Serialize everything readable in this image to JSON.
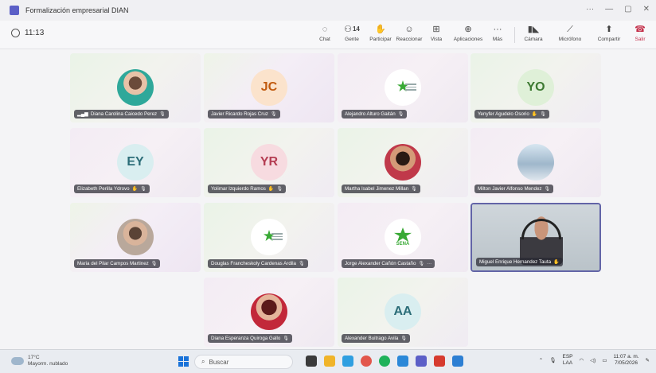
{
  "window": {
    "title": "Formalización empresarial DIAN",
    "controls": [
      "···",
      "—",
      "▢",
      "✕"
    ]
  },
  "toolbar": {
    "timer": "11:13",
    "buttons": [
      {
        "label": "Chat",
        "icon": "chat-icon",
        "glyph": "💬"
      },
      {
        "label": "Gente",
        "icon": "people-icon",
        "glyph": "👥",
        "count": "14"
      },
      {
        "label": "Participar",
        "icon": "raise-hand-icon",
        "glyph": "✋"
      },
      {
        "label": "Reaccionar",
        "icon": "react-icon",
        "glyph": "☺"
      },
      {
        "label": "Vista",
        "icon": "view-icon",
        "glyph": "⊞"
      },
      {
        "label": "Aplicaciones",
        "icon": "apps-icon",
        "glyph": "⊞"
      },
      {
        "label": "Más",
        "icon": "more-icon",
        "glyph": "···"
      },
      {
        "label": "Cámara",
        "icon": "camera-off-icon",
        "glyph": "📷"
      },
      {
        "label": "Micrófono",
        "icon": "mic-off-icon",
        "glyph": "🎙"
      },
      {
        "label": "Compartir",
        "icon": "share-icon",
        "glyph": "⬆"
      },
      {
        "label": "Salir",
        "icon": "leave-icon",
        "glyph": "☎"
      }
    ]
  },
  "participants": [
    {
      "name": "Diana Carolina Caicedo Perez",
      "avatar": "photo",
      "muted": true,
      "signal": true
    },
    {
      "name": "Javier Ricardo Rojas Cruz",
      "initials": "JC",
      "muted": true
    },
    {
      "name": "Alejandro Alturo Gaitán",
      "avatar": "logo",
      "muted": true
    },
    {
      "name": "Yenyfer Agudelo Osorio",
      "initials": "YO",
      "muted": true,
      "hand": true
    },
    {
      "name": "Elizabeth Perilla Ydrovo",
      "initials": "EY",
      "muted": true,
      "hand": true
    },
    {
      "name": "Yolimar Izquierdo Ramos",
      "initials": "YR",
      "muted": true,
      "hand": true
    },
    {
      "name": "Martha Isabel Jimenez Millan",
      "avatar": "photo",
      "muted": true
    },
    {
      "name": "Milton Javier Alfonso Mendez",
      "avatar": "photo",
      "muted": true
    },
    {
      "name": "Maria del Pilar Campos Martinez",
      "avatar": "photo",
      "muted": true
    },
    {
      "name": "Douglas Francheskoly Cardenas Ardila",
      "avatar": "logo",
      "muted": true
    },
    {
      "name": "Jorge Alexander Cañón Castaño",
      "avatar": "sena-logo",
      "muted": true,
      "more": "···"
    },
    {
      "name": "Miguel Enrique Hernandez Tauta",
      "avatar": "video",
      "hand": true
    },
    {
      "name": "Diana Esperanza Quiroga Gallo",
      "avatar": "photo",
      "muted": true
    },
    {
      "name": "Alexander Buitrago Avila",
      "initials": "AA",
      "muted": true
    }
  ],
  "sena_text": "SENA",
  "taskbar": {
    "temperature": "17°C",
    "weather": "Mayorm. nublado",
    "search_placeholder": "Buscar",
    "language": "ESP",
    "language_sub": "LAA",
    "time": "11:07 a. m.",
    "date": "7/05/2026"
  }
}
